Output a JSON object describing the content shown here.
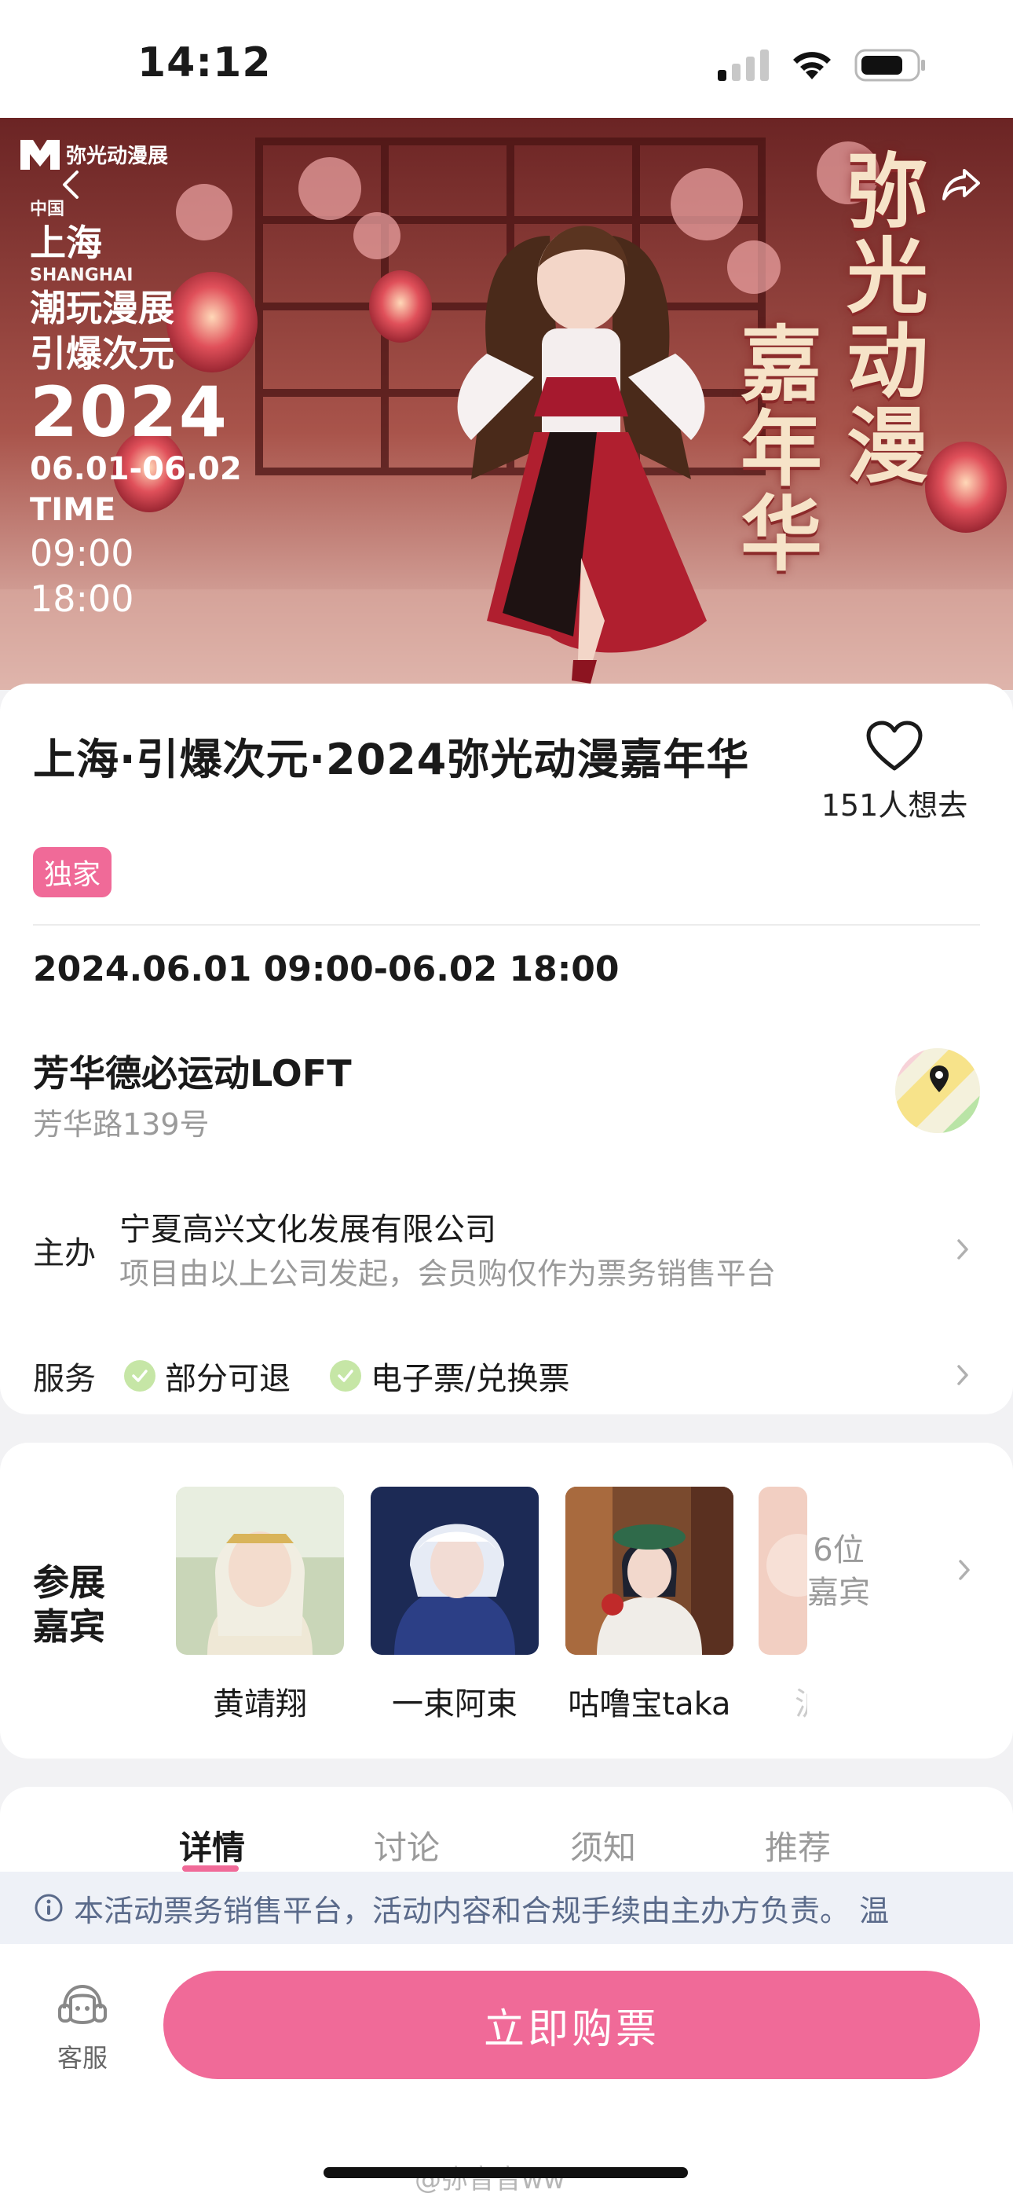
{
  "status_bar": {
    "time": "14:12"
  },
  "hero": {
    "brand": "弥光动漫展",
    "country": "中国",
    "city": "上海",
    "city_en": "SHANGHAI",
    "line1": "潮玩漫展",
    "line2": "引爆次元",
    "year": "2024",
    "dates": "06.01-06.02",
    "time_label": "TIME",
    "time_start": "09:00",
    "time_end": "18:00",
    "vertical_right": "弥光动漫",
    "vertical_left": "嘉年华"
  },
  "event": {
    "title": "上海·引爆次元·2024弥光动漫嘉年华",
    "want_count": "151人想去",
    "badge": "独家",
    "datetime": "2024.06.01 09:00-06.02 18:00",
    "venue_name": "芳华德必运动LOFT",
    "venue_address": "芳华路139号",
    "organizer_label": "主办",
    "organizer_name": "宁夏高兴文化发展有限公司",
    "organizer_note": "项目由以上公司发起，会员购仅作为票务销售平台",
    "service_label": "服务",
    "services": [
      "部分可退",
      "电子票/兑换票"
    ]
  },
  "guests": {
    "title": "参展嘉宾",
    "list": [
      {
        "name": "黄靖翔"
      },
      {
        "name": "一束阿束"
      },
      {
        "name": "咕噜宝taka"
      },
      {
        "name": "沪"
      }
    ],
    "more_count": "6位",
    "more_label": "嘉宾"
  },
  "tabs": [
    "详情",
    "讨论",
    "须知",
    "推荐"
  ],
  "notice": "本活动票务销售平台，活动内容和合规手续由主办方负责。 温",
  "bottom": {
    "service_label": "客服",
    "buy_label": "立即购票"
  },
  "watermark": "@弥音音ww",
  "colors": {
    "accent": "#f06a98",
    "check": "#c6e6a6"
  }
}
